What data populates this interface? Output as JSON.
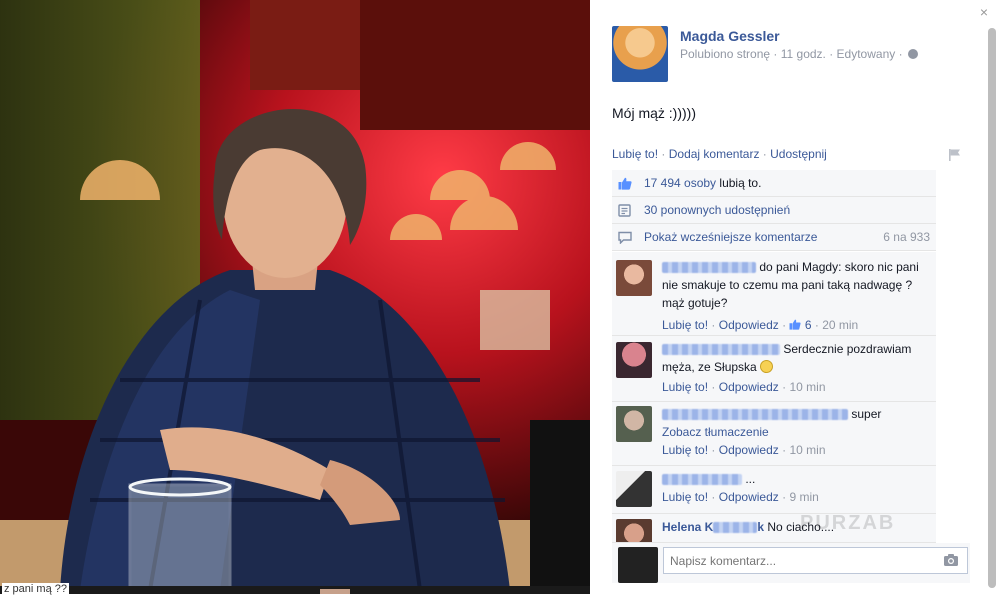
{
  "post": {
    "author": "Magda Gessler",
    "meta": "Polubiono stronę · 11 godz. · Edytowany ·",
    "text": "Mój mąż :)))))"
  },
  "actions": {
    "like": "Lubię to!",
    "comment": "Dodaj komentarz",
    "share": "Udostępnij",
    "sep": "·"
  },
  "ufi": {
    "likes_count": "17 494 osoby",
    "likes_suffix": "lubią to.",
    "shares": "30 ponownych udostępnień",
    "show_earlier": "Pokaż wcześniejsze komentarze",
    "pager": "6 na 933"
  },
  "comments": [
    {
      "text": "do pani Magdy: skoro nic pani nie smakuje to czemu ma pani taką nadwagę ? mąż gotuje?",
      "like": "Lubię to!",
      "reply": "Odpowiedz",
      "likes": "6",
      "time": "20 min"
    },
    {
      "text": "Serdecznie pozdrawiam męża, ze Słupska",
      "like": "Lubię to!",
      "reply": "Odpowiedz",
      "time": "10 min"
    },
    {
      "text": "super",
      "translate": "Zobacz tłumaczenie",
      "like": "Lubię to!",
      "reply": "Odpowiedz",
      "time": "10 min"
    },
    {
      "text": "...",
      "like": "Lubię to!",
      "reply": "Odpowiedz",
      "time": "9 min"
    },
    {
      "name_partial": "Helena K",
      "name_partial_end": "k",
      "text": "No ciacho...."
    }
  ],
  "reply_box": {
    "placeholder": "Napisz komentarz..."
  },
  "close_label": "×",
  "strip_text": "z pani mą ??",
  "watermark": "PURZAB",
  "colors": {
    "link": "#3b5998",
    "muted": "#9197a3",
    "panel_bg": "#f6f7f9"
  },
  "icons": {
    "close": "close-icon",
    "globe": "globe-icon",
    "flag": "flag-icon",
    "like": "thumbs-up-icon",
    "share": "share-icon",
    "comments": "comment-bubble-icon",
    "camera": "camera-icon",
    "emoji": "smiley-icon"
  }
}
